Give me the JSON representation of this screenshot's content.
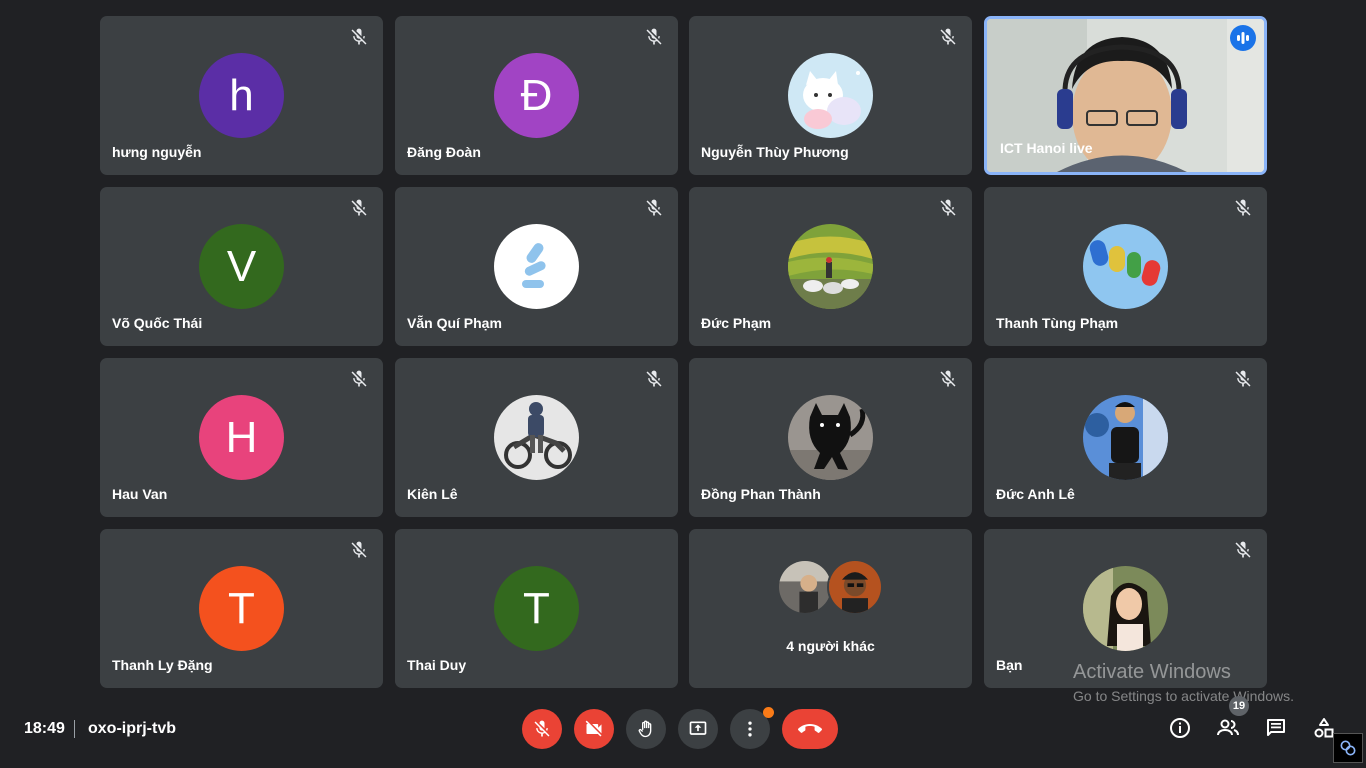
{
  "participants": [
    {
      "name": "hưng nguyễn",
      "initial": "h",
      "color": "#5b2ea6"
    },
    {
      "name": "Đăng Đoàn",
      "initial": "Đ",
      "color": "#a144c4"
    },
    {
      "name": "Nguyễn Thùy Phương",
      "avatar": "cartoon-cats-photo"
    },
    {
      "name": "ICT Hanoi live",
      "video": "webcam-man-headset",
      "speaking": true
    },
    {
      "name": "Võ Quốc Thái",
      "initial": "V",
      "color": "#33691e"
    },
    {
      "name": "Vẵn Quí Phạm",
      "avatar": "logo-photo"
    },
    {
      "name": "Đức Phạm",
      "avatar": "rice-terrace-photo"
    },
    {
      "name": "Thanh Tùng Phạm",
      "avatar": "2014-balloons-photo"
    },
    {
      "name": "Hau Van",
      "initial": "H",
      "color": "#e8437c"
    },
    {
      "name": "Kiên Lê",
      "avatar": "motorbike-photo"
    },
    {
      "name": "Đồng Phan Thành",
      "avatar": "black-cat-photo"
    },
    {
      "name": "Đức Anh Lê",
      "avatar": "person-photo"
    },
    {
      "name": "Thanh Ly Đặng",
      "initial": "T",
      "color": "#f4511e"
    },
    {
      "name": "Thai Duy",
      "initial": "T",
      "color": "#33691e"
    },
    {
      "others": "4 người khác"
    },
    {
      "name": "Bạn",
      "avatar": "self-photo"
    }
  ],
  "bottombar": {
    "time": "18:49",
    "meeting_code": "oxo-iprj-tvb",
    "people_count": "19"
  },
  "watermark": {
    "title": "Activate Windows",
    "subtitle": "Go to Settings to activate Windows."
  }
}
